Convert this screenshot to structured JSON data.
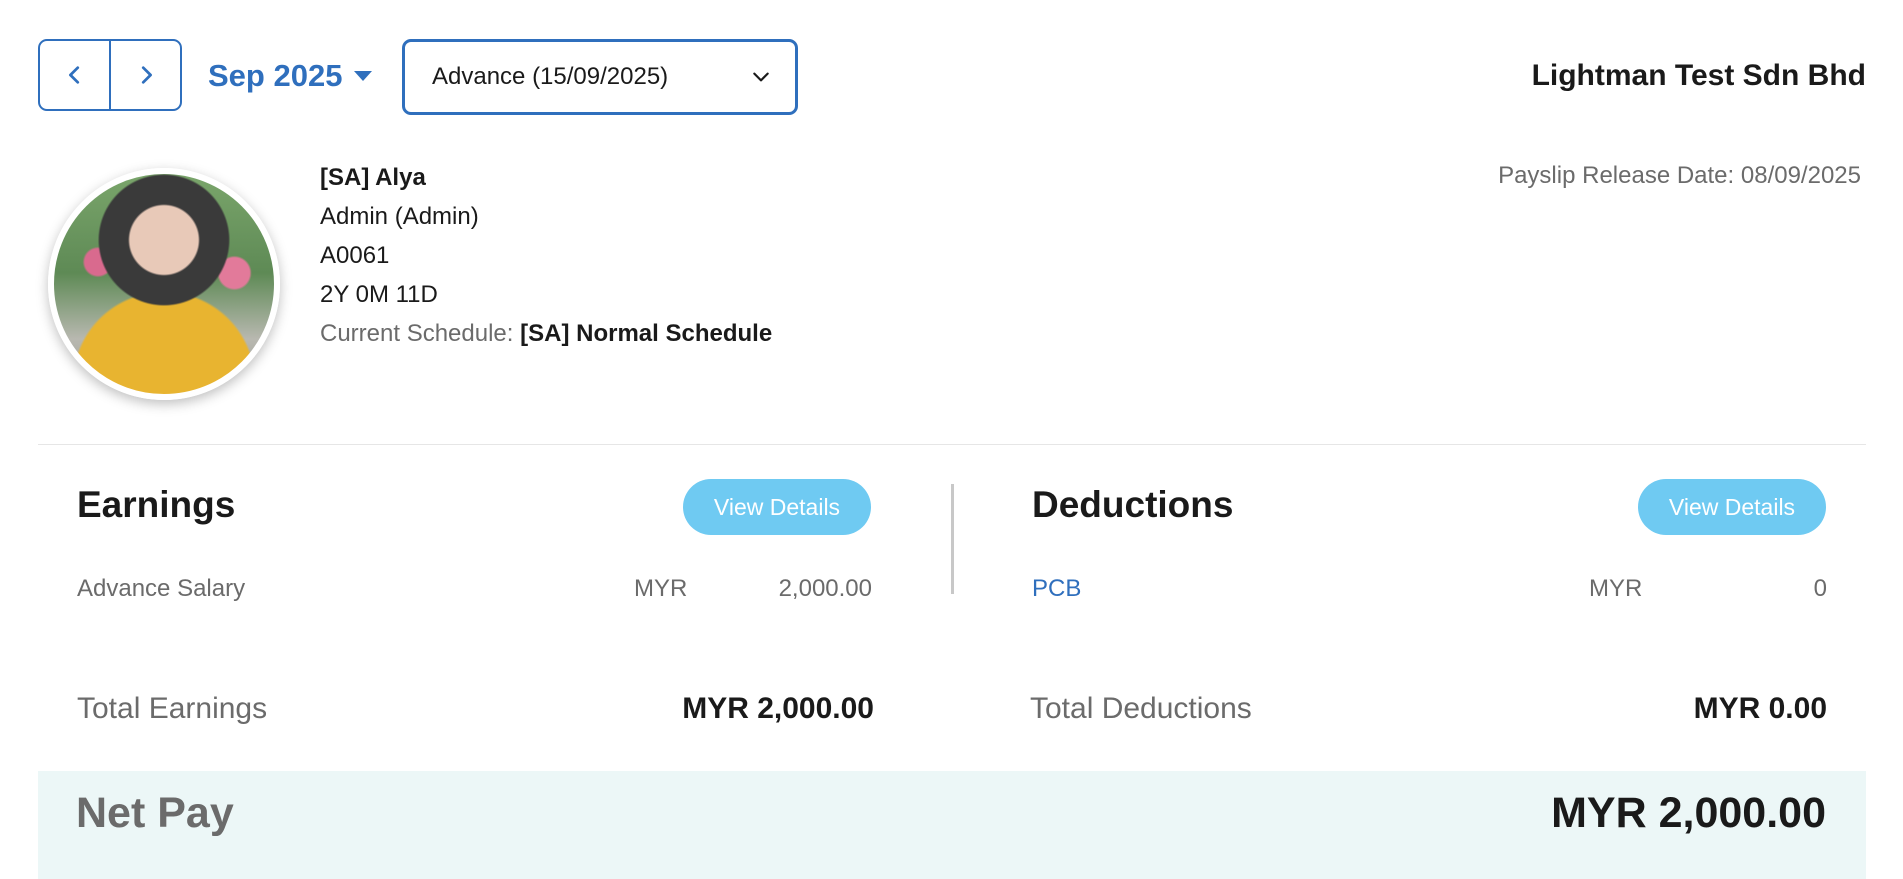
{
  "header": {
    "month_label": "Sep 2025",
    "period_selected": "Advance (15/09/2025)",
    "company_name": "Lightman Test Sdn Bhd"
  },
  "employee": {
    "name": "[SA] Alya",
    "role": "Admin (Admin)",
    "id": "A0061",
    "tenure": "2Y 0M 11D",
    "schedule_label": "Current Schedule:",
    "schedule_value": "[SA] Normal Schedule"
  },
  "payslip": {
    "release_label": "Payslip Release Date:",
    "release_date": "08/09/2025"
  },
  "earnings": {
    "title": "Earnings",
    "view_details_label": "View Details",
    "items": [
      {
        "name": "Advance Salary",
        "currency": "MYR",
        "amount": "2,000.00"
      }
    ],
    "total_label": "Total Earnings",
    "total_value": "MYR 2,000.00"
  },
  "deductions": {
    "title": "Deductions",
    "view_details_label": "View Details",
    "items": [
      {
        "name": "PCB",
        "currency": "MYR",
        "amount": "0"
      }
    ],
    "total_label": "Total Deductions",
    "total_value": "MYR 0.00"
  },
  "net_pay": {
    "label": "Net Pay",
    "value": "MYR 2,000.00"
  },
  "colors": {
    "accent": "#2f6fbd",
    "button": "#6fcaf2",
    "netpay_bg": "#ecf7f7"
  }
}
